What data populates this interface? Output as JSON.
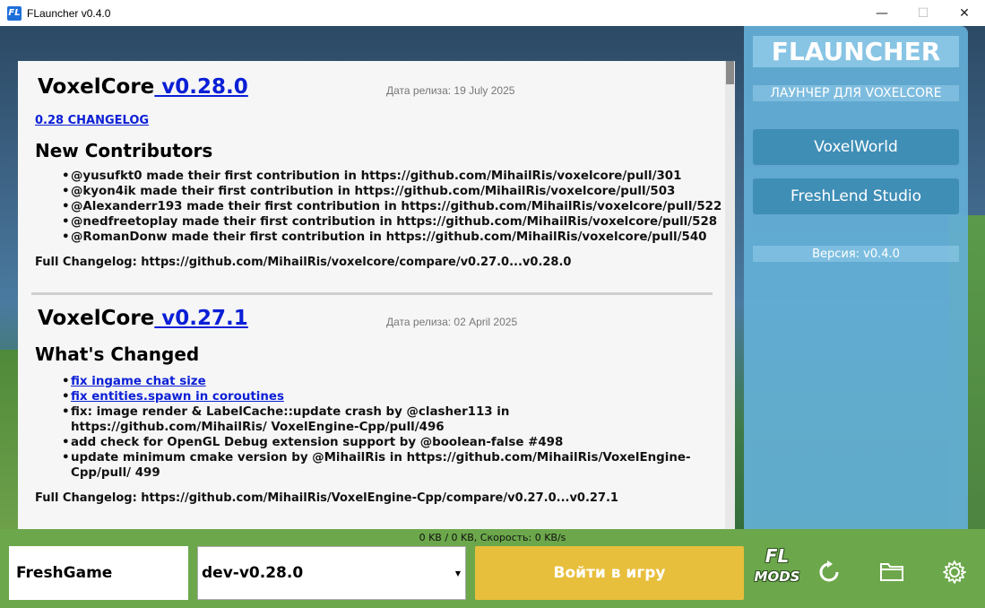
{
  "window": {
    "title": "FLauncher v0.4.0",
    "icon_text": "FL",
    "minimize": "—",
    "maximize": "☐",
    "close": "✕"
  },
  "releases": [
    {
      "product": "VoxelCore",
      "version": " v0.28.0",
      "date": "Дата релиза: 19 July 2025",
      "changelog_link": "0.28 CHANGELOG",
      "section_title": "New Contributors",
      "items": [
        "@yusufkt0 made their first contribution in https://github.com/MihailRis/voxelcore/pull/301",
        "@kyon4ik made their first contribution in https://github.com/MihailRis/voxelcore/pull/503",
        "@Alexanderr193 made their first contribution in https://github.com/MihailRis/voxelcore/pull/522",
        "@nedfreetoplay made their first contribution in https://github.com/MihailRis/voxelcore/pull/528",
        "@RomanDonw made their first contribution in https://github.com/MihailRis/voxelcore/pull/540"
      ],
      "full_changelog": "Full Changelog: https://github.com/MihailRis/voxelcore/compare/v0.27.0...v0.28.0"
    },
    {
      "product": "VoxelCore",
      "version": " v0.27.1",
      "date": "Дата релиза: 02 April 2025",
      "section_title": "What's Changed",
      "link_items": [
        "fix ingame chat size",
        "fix entities.spawn in coroutines"
      ],
      "items": [
        "fix: image render & LabelCache::update crash by @clasher113 in https://github.com/MihailRis/ VoxelEngine-Cpp/pull/496",
        "add check for OpenGL Debug extension support by @boolean-false #498",
        "update minimum cmake version by @MihailRis in https://github.com/MihailRis/VoxelEngine-Cpp/pull/ 499"
      ],
      "full_changelog": "Full Changelog: https://github.com/MihailRis/VoxelEngine-Cpp/compare/v0.27.0...v0.27.1"
    }
  ],
  "sidebar": {
    "logo": "FLAUNCHER",
    "tagline": "ЛАУНЧЕР ДЛЯ VOXELCORE",
    "buttons": [
      "VoxelWorld",
      "FreshLend Studio"
    ],
    "version": "Версия: v0.4.0"
  },
  "bottom": {
    "status": "0 KB / 0 KB, Скорость: 0 KB/s",
    "username": "FreshGame",
    "selected_version": "dev-v0.28.0",
    "play_label": "Войти в игру",
    "mods_logo_top": "FL",
    "mods_logo_bottom": "MODS",
    "icons": [
      "refresh-icon",
      "folder-icon",
      "gear-icon"
    ]
  },
  "colors": {
    "accent_yellow": "#e8bf3c",
    "bottom_green": "#6ca84b",
    "sidebar_blue": "#64afd7",
    "link_blue": "#0b1fd6"
  }
}
